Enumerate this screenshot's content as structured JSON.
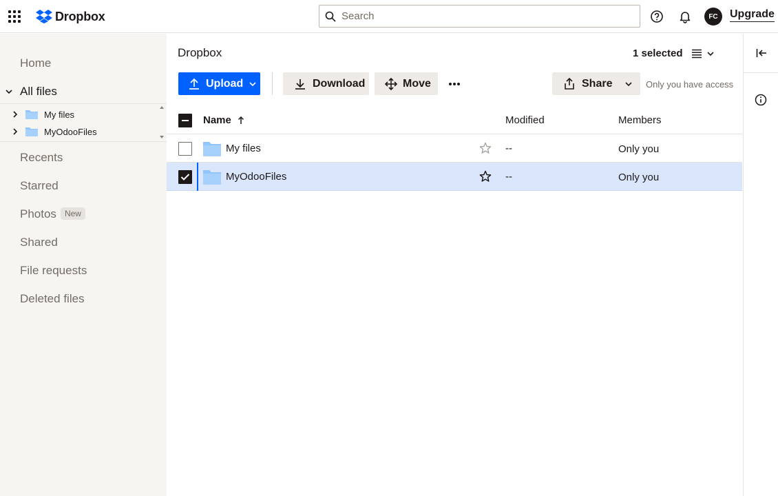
{
  "app": {
    "brand": "Dropbox",
    "search_placeholder": "Search",
    "avatar_initials": "FC",
    "upgrade_label": "Upgrade",
    "accent_color": "#0061fe"
  },
  "sidebar": {
    "home": "Home",
    "all_files": "All files",
    "tree": [
      {
        "label": "My files"
      },
      {
        "label": "MyOdooFiles"
      }
    ],
    "recents": "Recents",
    "starred": "Starred",
    "photos": "Photos",
    "photos_badge": "New",
    "shared": "Shared",
    "file_requests": "File requests",
    "deleted_files": "Deleted files"
  },
  "main": {
    "title": "Dropbox",
    "selected_count": "1 selected",
    "toolbar": {
      "upload": "Upload",
      "download": "Download",
      "move": "Move",
      "share": "Share",
      "access": "Only you have access"
    },
    "columns": {
      "name": "Name",
      "modified": "Modified",
      "members": "Members"
    },
    "rows": [
      {
        "name": "My files",
        "modified": "--",
        "members": "Only you",
        "selected": false
      },
      {
        "name": "MyOdooFiles",
        "modified": "--",
        "members": "Only you",
        "selected": true
      }
    ]
  }
}
